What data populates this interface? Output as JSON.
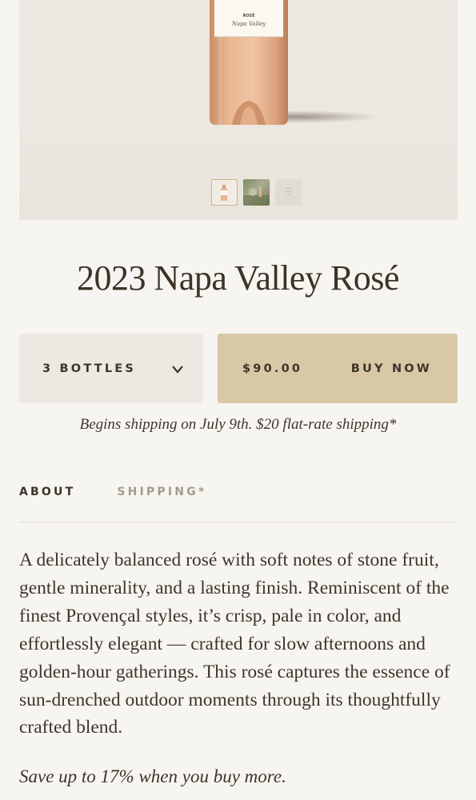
{
  "product": {
    "label_text": "ROSÉ",
    "label_script": "Napa Valley",
    "title": "2023 Napa Valley Rosé"
  },
  "gallery": {
    "thumbnails": [
      "bottle",
      "outdoor scene",
      "label detail"
    ],
    "active_index": 0
  },
  "purchase": {
    "quantity_label": "3 BOTTLES",
    "price": "$90.00",
    "buy_label": "BUY NOW"
  },
  "shipping_note": "Begins shipping on July 9th. $20 flat-rate shipping*",
  "tabs": [
    {
      "label": "ABOUT",
      "active": true
    },
    {
      "label": "SHIPPING*",
      "active": false
    }
  ],
  "description": "A delicately balanced rosé with soft notes of stone fruit, gentle minerality, and a lasting finish. Reminiscent of the finest Provençal styles, it’s crisp, pale in color, and effortlessly elegant — crafted for slow afternoons and golden-hour gatherings. This rosé captures the essence of sun-drenched outdoor moments through its thoughtfully crafted blend.",
  "promo": "Save up to 17% when you buy more.",
  "colors": {
    "background": "#f7f5f1",
    "hero_bg": "#ece7e0",
    "buy_button": "#d8c8a6",
    "quantity_button": "#ede8e1",
    "text": "#3d3528",
    "muted_tab": "#a59a88"
  }
}
